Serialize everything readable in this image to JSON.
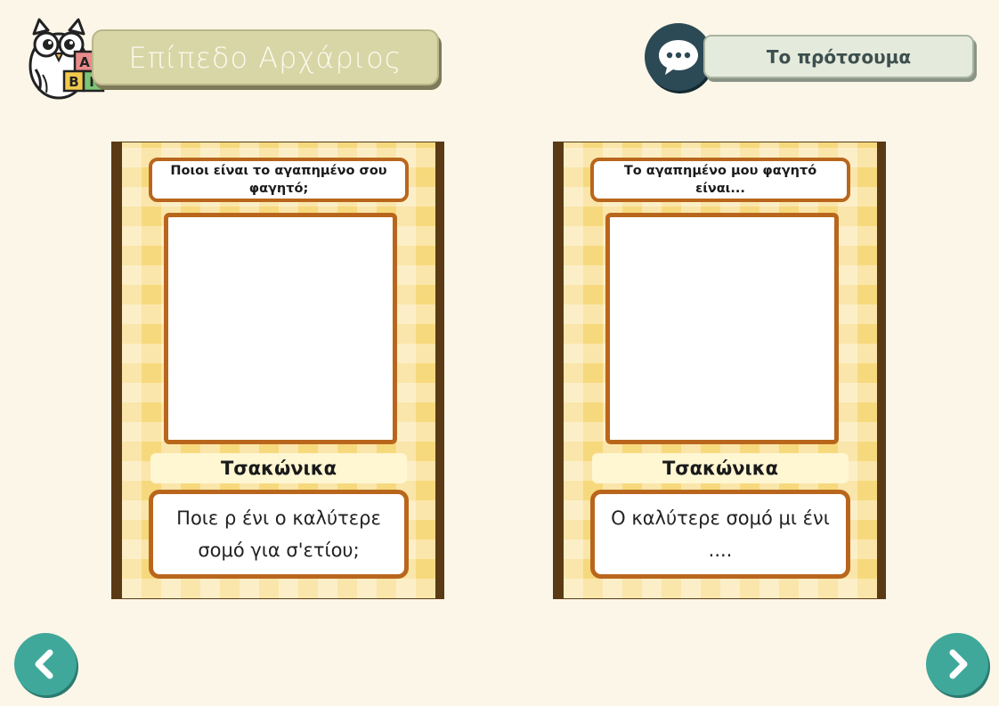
{
  "header": {
    "level_title": "Επίπεδο Αρχάριος",
    "example_label": "Το πρότσουμα",
    "owl_blocks": [
      "Α",
      "Β",
      "Γ"
    ]
  },
  "cards": [
    {
      "question": "Ποιοι είναι το αγαπημένο σου φαγητό;",
      "language": "Τσακώνικα",
      "phrase": "Ποιε ρ ένι ο καλύτερε σομό για σ'ετίου;"
    },
    {
      "question": "Το αγαπημένο μου φαγητό είναι...",
      "language": "Τσακώνικα",
      "phrase": "Ο καλύτερε σομό μι ένι ...."
    }
  ],
  "icons": {
    "speech": "speech-bubble-icon",
    "prev": "chevron-left-icon",
    "next": "chevron-right-icon",
    "mascot": "owl-icon"
  },
  "colors": {
    "background": "#fbf6e8",
    "card_fill": "#f7d97d",
    "card_border": "#b9661d",
    "card_frame": "#5a3a14",
    "nav_button": "#3fa89a",
    "speech_button": "#2c4a55",
    "level_banner": "#d8d6a6"
  }
}
